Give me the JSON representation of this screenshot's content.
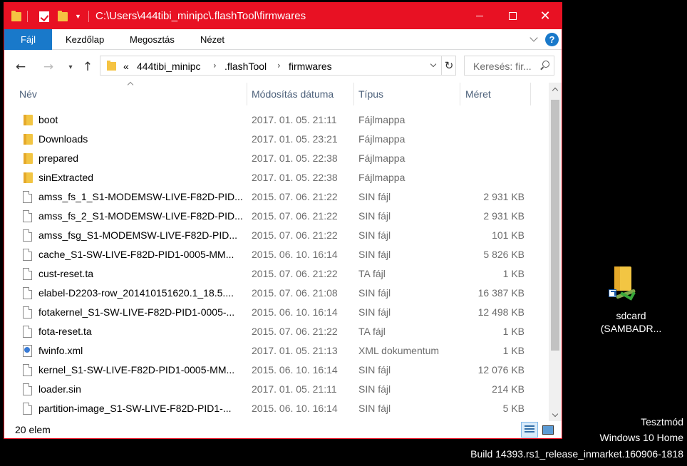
{
  "window": {
    "title": "C:\\Users\\444tibi_minipc\\.flashTool\\firmwares",
    "accent": "#e81123"
  },
  "ribbon": {
    "tabs": [
      "Fájl",
      "Kezdőlap",
      "Megosztás",
      "Nézet"
    ],
    "help": "?"
  },
  "address": {
    "overflow": "«",
    "crumbs": [
      "444tibi_minipc",
      ".flashTool",
      "firmwares"
    ]
  },
  "search": {
    "placeholder": "Keresés: fir..."
  },
  "columns": {
    "name": "Név",
    "date": "Módosítás dátuma",
    "type": "Típus",
    "size": "Méret"
  },
  "files": [
    {
      "name": "boot",
      "date": "2017. 01. 05. 21:11",
      "type": "Fájlmappa",
      "size": "",
      "icon": "folder"
    },
    {
      "name": "Downloads",
      "date": "2017. 01. 05. 23:21",
      "type": "Fájlmappa",
      "size": "",
      "icon": "folder"
    },
    {
      "name": "prepared",
      "date": "2017. 01. 05. 22:38",
      "type": "Fájlmappa",
      "size": "",
      "icon": "folder"
    },
    {
      "name": "sinExtracted",
      "date": "2017. 01. 05. 22:38",
      "type": "Fájlmappa",
      "size": "",
      "icon": "folder"
    },
    {
      "name": "amss_fs_1_S1-MODEMSW-LIVE-F82D-PID...",
      "date": "2015. 07. 06. 21:22",
      "type": "SIN fájl",
      "size": "2 931 KB",
      "icon": "file"
    },
    {
      "name": "amss_fs_2_S1-MODEMSW-LIVE-F82D-PID...",
      "date": "2015. 07. 06. 21:22",
      "type": "SIN fájl",
      "size": "2 931 KB",
      "icon": "file"
    },
    {
      "name": "amss_fsg_S1-MODEMSW-LIVE-F82D-PID...",
      "date": "2015. 07. 06. 21:22",
      "type": "SIN fájl",
      "size": "101 KB",
      "icon": "file"
    },
    {
      "name": "cache_S1-SW-LIVE-F82D-PID1-0005-MM...",
      "date": "2015. 06. 10. 16:14",
      "type": "SIN fájl",
      "size": "5 826 KB",
      "icon": "file"
    },
    {
      "name": "cust-reset.ta",
      "date": "2015. 07. 06. 21:22",
      "type": "TA fájl",
      "size": "1 KB",
      "icon": "file"
    },
    {
      "name": "elabel-D2203-row_201410151620.1_18.5....",
      "date": "2015. 07. 06. 21:08",
      "type": "SIN fájl",
      "size": "16 387 KB",
      "icon": "file"
    },
    {
      "name": "fotakernel_S1-SW-LIVE-F82D-PID1-0005-...",
      "date": "2015. 06. 10. 16:14",
      "type": "SIN fájl",
      "size": "12 498 KB",
      "icon": "file"
    },
    {
      "name": "fota-reset.ta",
      "date": "2015. 07. 06. 21:22",
      "type": "TA fájl",
      "size": "1 KB",
      "icon": "file"
    },
    {
      "name": "fwinfo.xml",
      "date": "2017. 01. 05. 21:13",
      "type": "XML dokumentum",
      "size": "1 KB",
      "icon": "xml"
    },
    {
      "name": "kernel_S1-SW-LIVE-F82D-PID1-0005-MM...",
      "date": "2015. 06. 10. 16:14",
      "type": "SIN fájl",
      "size": "12 076 KB",
      "icon": "file"
    },
    {
      "name": "loader.sin",
      "date": "2017. 01. 05. 21:11",
      "type": "SIN fájl",
      "size": "214 KB",
      "icon": "file"
    },
    {
      "name": "partition-image_S1-SW-LIVE-F82D-PID1-...",
      "date": "2015. 06. 10. 16:14",
      "type": "SIN fájl",
      "size": "5 KB",
      "icon": "file"
    }
  ],
  "status": {
    "count": "20 elem"
  },
  "desktop": {
    "icon_label_1": "sdcard",
    "icon_label_2": "(SAMBADR...",
    "watermark": [
      "Tesztmód",
      "Windows 10 Home",
      "Build 14393.rs1_release_inmarket.160906-1818"
    ]
  }
}
